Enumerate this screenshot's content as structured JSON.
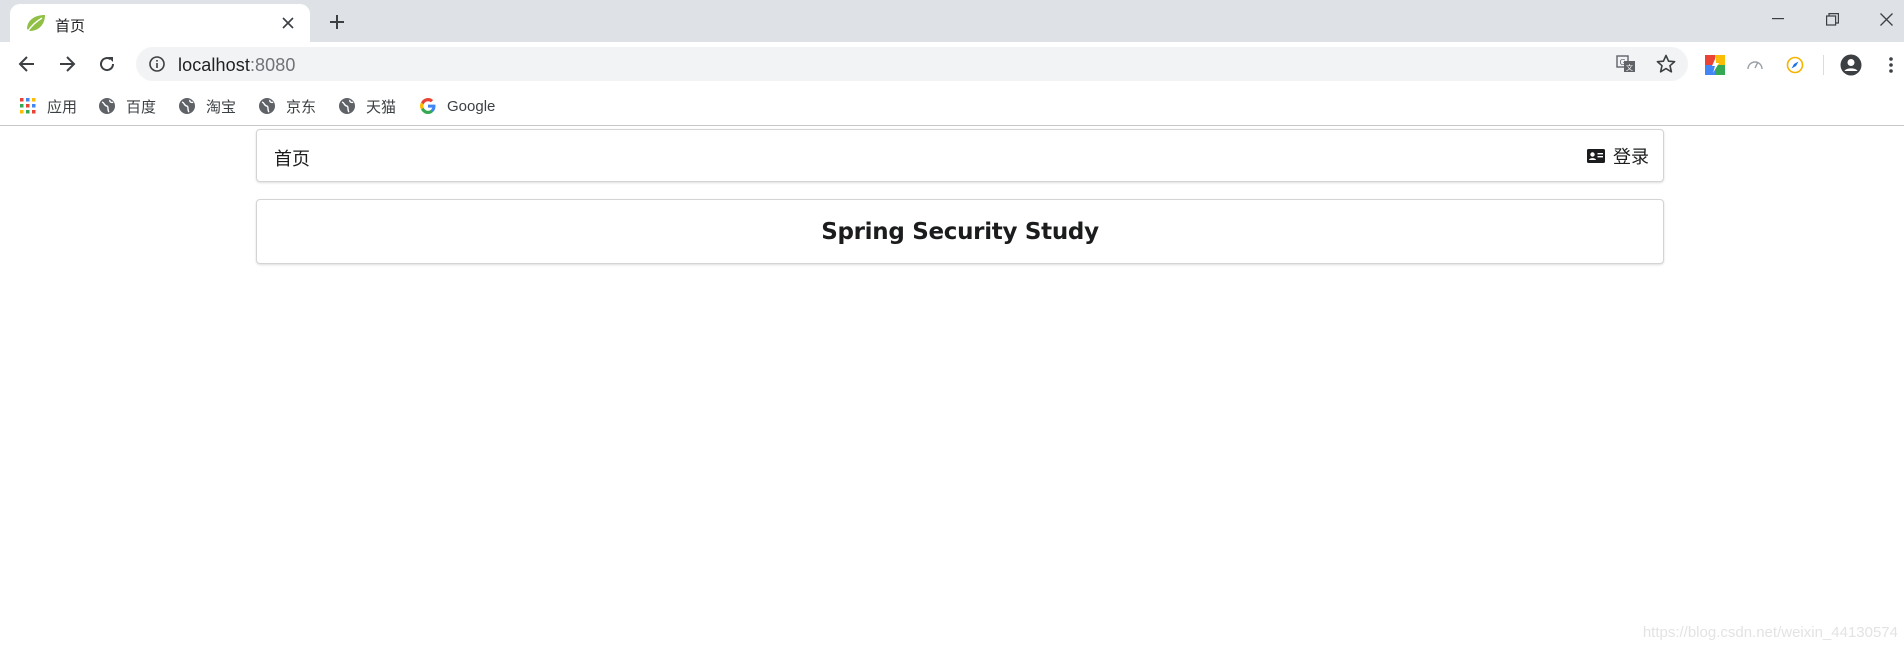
{
  "browser": {
    "tab": {
      "title": "首页"
    },
    "url": {
      "host": "localhost",
      "port": ":8080"
    },
    "bookmarks": [
      {
        "label": "应用",
        "icon": "apps-grid-icon"
      },
      {
        "label": "百度",
        "icon": "globe-icon"
      },
      {
        "label": "淘宝",
        "icon": "globe-icon"
      },
      {
        "label": "京东",
        "icon": "globe-icon"
      },
      {
        "label": "天猫",
        "icon": "globe-icon"
      },
      {
        "label": "Google",
        "icon": "google-icon"
      }
    ]
  },
  "page": {
    "nav": {
      "home_label": "首页",
      "login_label": "登录"
    },
    "header": {
      "title": "Spring Security Study"
    }
  },
  "watermark": "https://blog.csdn.net/weixin_44130574",
  "colors": {
    "tabstrip": "#dee1e6",
    "omnibox": "#f1f3f4",
    "segment_border": "#d4d4d5",
    "text": "#1b1c1d"
  }
}
